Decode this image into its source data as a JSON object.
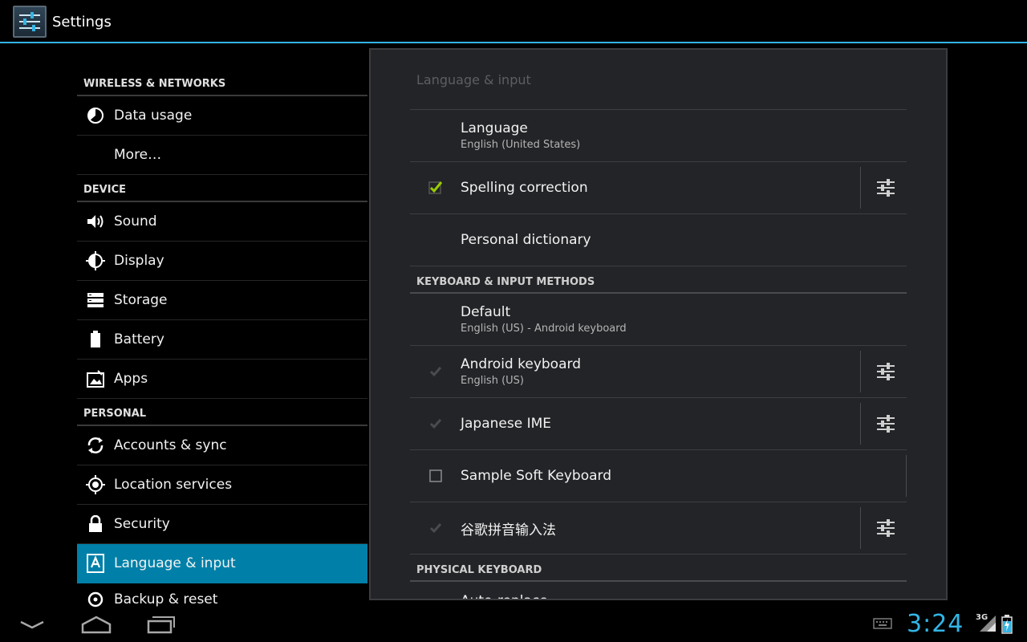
{
  "app": {
    "title": "Settings",
    "icon": "settings-sliders-icon"
  },
  "left_nav": {
    "wireless_header": "WIRELESS & NETWORKS",
    "data_usage": "Data usage",
    "more": "More…",
    "device_header": "DEVICE",
    "sound": "Sound",
    "display": "Display",
    "storage": "Storage",
    "battery": "Battery",
    "apps": "Apps",
    "personal_header": "PERSONAL",
    "accounts": "Accounts & sync",
    "location": "Location services",
    "security": "Security",
    "language": "Language & input",
    "backup": "Backup & reset",
    "active_item": "Language & input",
    "accent_color": "#0080a8"
  },
  "panel": {
    "title": "Language & input",
    "language": {
      "title": "Language",
      "summary": "English (United States)"
    },
    "spelling": {
      "title": "Spelling correction",
      "checked": true
    },
    "dictionary": {
      "title": "Personal dictionary"
    },
    "keyboard_header": "KEYBOARD & INPUT METHODS",
    "default": {
      "title": "Default",
      "summary": "English (US) - Android keyboard"
    },
    "android_kb": {
      "title": "Android keyboard",
      "summary": "English (US)",
      "checked": true,
      "disabled": true
    },
    "japanese": {
      "title": "Japanese IME",
      "checked": true,
      "disabled": true
    },
    "sample": {
      "title": "Sample Soft Keyboard",
      "checked": false
    },
    "pinyin": {
      "title": "谷歌拼音输入法",
      "checked": true,
      "disabled": true
    },
    "physical_header": "PHYSICAL KEYBOARD",
    "auto_replace": {
      "title": "Auto-replace"
    }
  },
  "status": {
    "clock": "3:24",
    "network": "3G",
    "accent": "#33b5e5"
  }
}
